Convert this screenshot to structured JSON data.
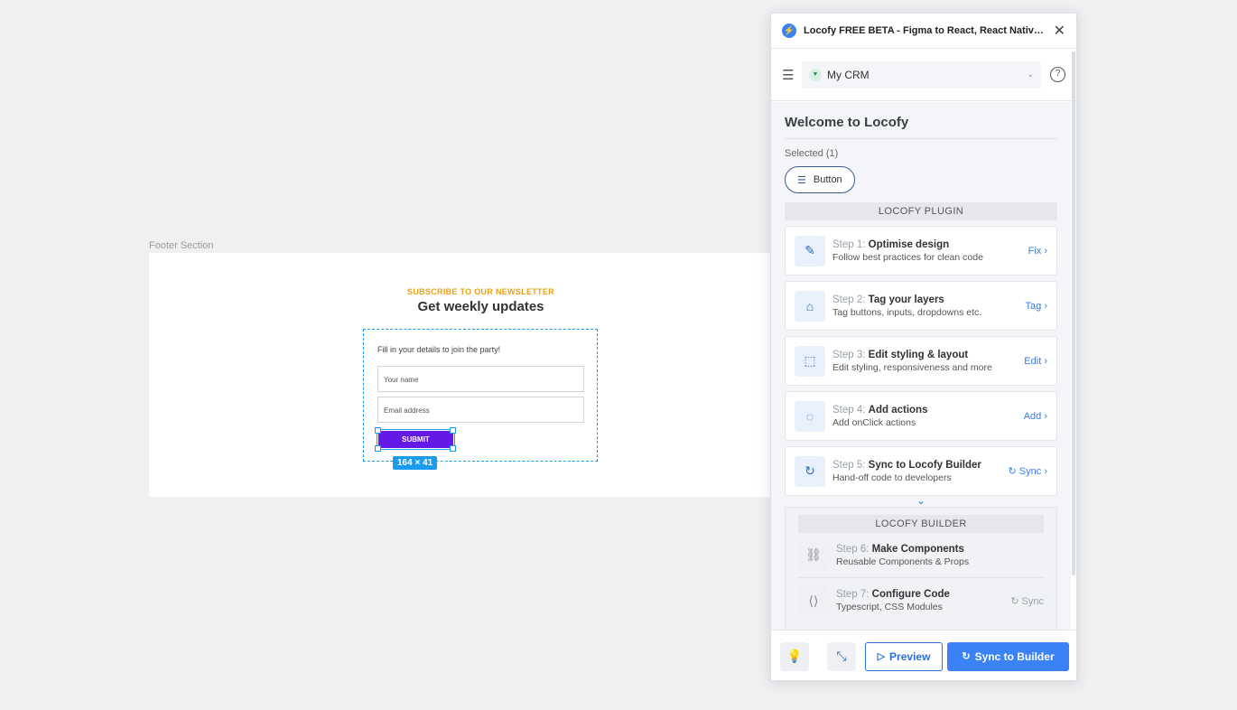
{
  "canvas": {
    "frame_label": "Footer Section",
    "eyebrow": "SUBSCRIBE TO OUR NEWSLETTER",
    "headline": "Get weekly updates",
    "form_hint": "Fill in your details to join the party!",
    "name_placeholder": "Your name",
    "email_placeholder": "Email address",
    "submit_label": "SUBMIT",
    "selection_size": "164 × 41"
  },
  "plugin": {
    "title": "Locofy FREE BETA - Figma to React, React Native, HTML/CSS, Next.js, Gatsby, Vue",
    "project": "My CRM",
    "welcome": "Welcome to Locofy",
    "selected": "Selected (1)",
    "selected_chip": "Button",
    "plugin_section": "LOCOFY PLUGIN",
    "steps": [
      {
        "num": "Step 1:",
        "name": "Optimise design",
        "desc": "Follow best practices for clean code",
        "action": "Fix",
        "icon": "magic-wand-icon"
      },
      {
        "num": "Step 2:",
        "name": "Tag your layers",
        "desc": "Tag buttons, inputs, dropdowns etc.",
        "action": "Tag",
        "icon": "tag-icon"
      },
      {
        "num": "Step 3:",
        "name": "Edit styling & layout",
        "desc": "Edit styling, responsiveness and more",
        "action": "Edit",
        "icon": "edit-layout-icon"
      },
      {
        "num": "Step 4:",
        "name": "Add actions",
        "desc": "Add onClick actions",
        "action": "Add",
        "icon": "actions-icon"
      },
      {
        "num": "Step 5:",
        "name": "Sync to Locofy Builder",
        "desc": "Hand-off code to developers",
        "action": "Sync",
        "icon": "sync-icon"
      }
    ],
    "builder_section": "LOCOFY BUILDER",
    "builder_steps": [
      {
        "num": "Step 6:",
        "name": "Make Components",
        "desc": "Reusable Components & Props",
        "action": "",
        "icon": "link-icon"
      },
      {
        "num": "Step 7:",
        "name": "Configure Code",
        "desc": "Typescript, CSS Modules",
        "action": "Sync",
        "icon": "code-icon"
      }
    ],
    "footer": {
      "preview_label": "Preview",
      "sync_label": "Sync to Builder"
    }
  },
  "colors": {
    "accent": "#3b82f6",
    "submit": "#6419e6",
    "eyebrow": "#e8a317",
    "selection": "#1b9bf0"
  }
}
